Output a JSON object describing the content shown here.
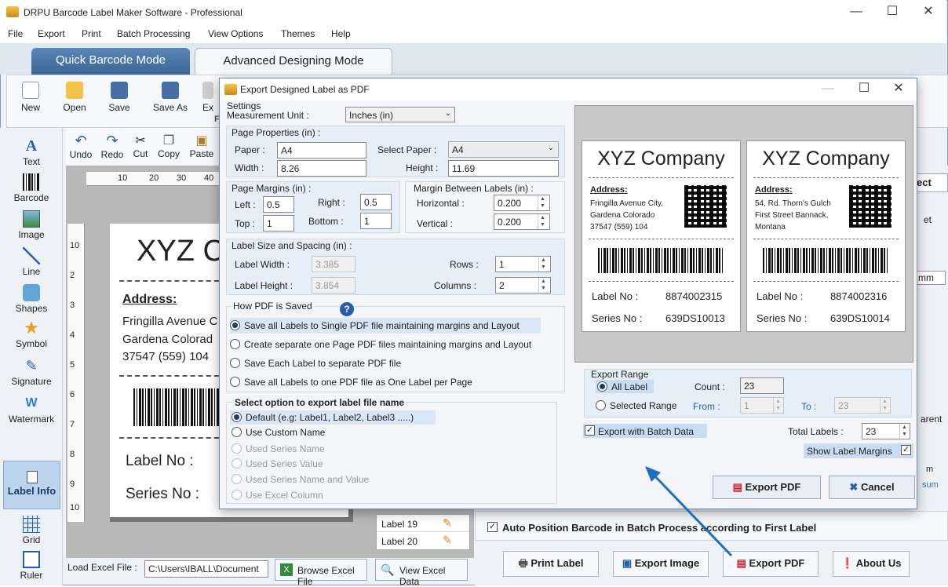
{
  "app": {
    "title": "DRPU Barcode Label Maker Software - Professional",
    "min": "—",
    "max": "☐",
    "close": "✕"
  },
  "menu": [
    "File",
    "Export",
    "Print",
    "Batch Processing",
    "View Options",
    "Themes",
    "Help"
  ],
  "modes": {
    "quick": "Quick Barcode Mode",
    "advanced": "Advanced Designing Mode"
  },
  "toolbar": {
    "new": "New",
    "open": "Open",
    "save": "Save",
    "save_as": "Save As",
    "ex": "Ex",
    "f": "F"
  },
  "edit": {
    "undo": "Undo",
    "redo": "Redo",
    "cut": "Cut",
    "copy": "Copy",
    "paste": "Paste"
  },
  "tools": [
    "Text",
    "Barcode",
    "Image",
    "Line",
    "Shapes",
    "Symbol",
    "Signature",
    "Watermark"
  ],
  "label_info": "Label Info",
  "grid": "Grid",
  "ruler": "Ruler",
  "ruler_h": [
    "10",
    "20",
    "30",
    "40"
  ],
  "ruler_v": [
    "10",
    "2",
    "3",
    "4",
    "5",
    "6",
    "7",
    "8",
    "9",
    "10"
  ],
  "canvas": {
    "company": "XYZ Co",
    "address_title": "Address:",
    "addr1": "Fringilla Avenue C",
    "addr2": "Gardena Colorad",
    "addr3": "37547 (559) 104",
    "label_no": "Label No :",
    "series_no": "Series No :"
  },
  "labels_list": [
    "Label 19",
    "Label 20"
  ],
  "excel": {
    "load": "Load Excel File :",
    "path": "C:\\Users\\IBALL\\Document",
    "browse": "Browse Excel File",
    "view": "View Excel Data"
  },
  "right_partial": {
    "ect": "ect",
    "et": "et",
    "mm": "mm",
    "arent": "arent",
    "m": "m",
    "sum": "sum"
  },
  "auto_position": "Auto Position Barcode in Batch Process according to First Label",
  "bottom_buttons": {
    "print": "Print Label",
    "export_image": "Export Image",
    "export_pdf": "Export PDF",
    "about": "About Us"
  },
  "dialog": {
    "title": "Export Designed Label as PDF",
    "settings": "Settings",
    "measurement_unit": "Measurement Unit :",
    "unit_value": "Inches (in)",
    "page_props": "Page Properties (in) :",
    "paper_label": "Paper :",
    "paper_value": "A4",
    "select_paper_label": "Select Paper :",
    "select_paper_value": "A4",
    "width_label": "Width :",
    "width_value": "8.26",
    "height_label": "Height :",
    "height_value": "11.69",
    "margins": "Page Margins (in) :",
    "left_label": "Left :",
    "left_value": "0.5",
    "right_label": "Right :",
    "right_value": "0.5",
    "top_label": "Top :",
    "top_value": "1",
    "bottom_label": "Bottom :",
    "bottom_value": "1",
    "between": "Margin Between Labels (in) :",
    "horizontal_label": "Horizontal :",
    "horizontal_value": "0.200",
    "vertical_label": "Vertical :",
    "vertical_value": "0.200",
    "size_spacing": "Label Size and Spacing (in) :",
    "label_width_label": "Label Width :",
    "label_width_value": "3.385",
    "label_height_label": "Label Height :",
    "label_height_value": "3.854",
    "rows_label": "Rows :",
    "rows_value": "1",
    "columns_label": "Columns :",
    "columns_value": "2",
    "how_saved": "How PDF is Saved",
    "save_opts": [
      "Save all Labels to Single PDF file maintaining margins and Layout",
      "Create separate one Page PDF files maintaining margins and Layout",
      "Save Each Label to separate PDF file",
      "Save all Labels to one PDF file as One Label per Page"
    ],
    "name_title": "Select option to export label file name",
    "name_opts": [
      "Default (e.g: Label1, Label2, Label3  .....)",
      "Use Custom Name",
      "Used Series Name",
      "Used Series Value",
      "Used Series Name and Value",
      "Use Excel Column"
    ],
    "preview": [
      {
        "company": "XYZ Company",
        "address_title": "Address:",
        "addr": [
          "Fringilla Avenue City,",
          "Gardena Colorado",
          "37547 (559) 104"
        ],
        "label_no_label": "Label No :",
        "label_no": "8874002315",
        "series_label": "Series No :",
        "series": "639DS10013"
      },
      {
        "company": "XYZ Company",
        "address_title": "Address:",
        "addr": [
          "54, Rd. Thorn's Gulch",
          "First Street Bannack,",
          "Montana"
        ],
        "label_no_label": "Label No :",
        "label_no": "8874002316",
        "series_label": "Series No :",
        "series": "639DS10014"
      }
    ],
    "export_range": "Export Range",
    "all_label": "All Label",
    "count_label": "Count :",
    "count_value": "23",
    "selected_range": "Selected Range",
    "from_label": "From :",
    "from_value": "1",
    "to_label": "To :",
    "to_value": "23",
    "batch_data": "Export with Batch Data",
    "total_label": "Total Labels :",
    "total_value": "23",
    "show_margins": "Show Label Margins",
    "export_btn": "Export PDF",
    "cancel_btn": "Cancel"
  }
}
